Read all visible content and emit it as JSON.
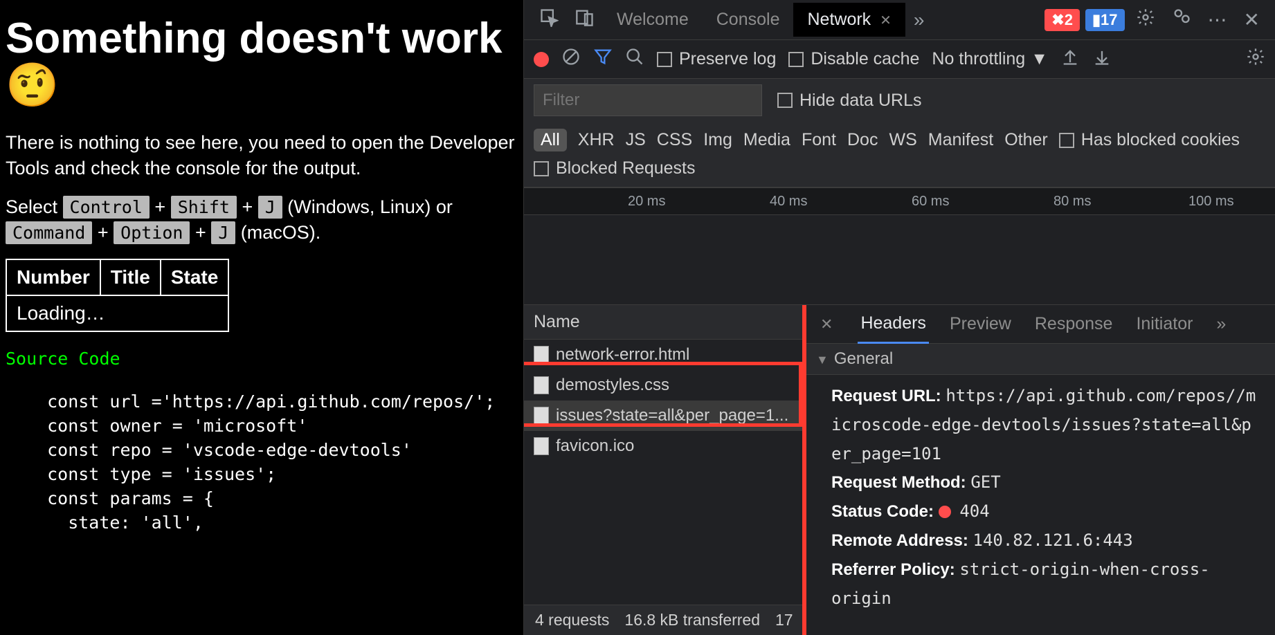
{
  "page": {
    "title": "Something doesn't work 🤨",
    "paragraph": "There is nothing to see here, you need to open the Developer Tools and check the console for the output.",
    "shortcut_prefix": "Select ",
    "kbd1": "Control",
    "plus": " + ",
    "kbd2": "Shift",
    "kbd3": "J",
    "suffix_win": " (Windows, Linux) or ",
    "kbd4": "Command",
    "kbd5": "Option",
    "kbd6": "J",
    "suffix_mac": " (macOS).",
    "table_headers": {
      "c1": "Number",
      "c2": "Title",
      "c3": "State"
    },
    "loading": "Loading…",
    "source_code_label": "Source Code",
    "code": "  const url ='https://api.github.com/repos/';\n  const owner = 'microsoft'\n  const repo = 'vscode-edge-devtools'\n  const type = 'issues';\n  const params = {\n    state: 'all',"
  },
  "tabs": {
    "welcome": "Welcome",
    "console": "Console",
    "network": "Network"
  },
  "badges": {
    "errors": "2",
    "messages": "17"
  },
  "toolbar": {
    "preserve_log": "Preserve log",
    "disable_cache": "Disable cache",
    "throttling": "No throttling"
  },
  "filter": {
    "placeholder": "Filter",
    "hide_data_urls": "Hide data URLs"
  },
  "types": {
    "all": "All",
    "xhr": "XHR",
    "js": "JS",
    "css": "CSS",
    "img": "Img",
    "media": "Media",
    "font": "Font",
    "doc": "Doc",
    "ws": "WS",
    "manifest": "Manifest",
    "other": "Other",
    "blocked_cookies": "Has blocked cookies",
    "blocked_requests": "Blocked Requests"
  },
  "ruler": {
    "t1": "20 ms",
    "t2": "40 ms",
    "t3": "60 ms",
    "t4": "80 ms",
    "t5": "100 ms"
  },
  "list_header": "Name",
  "requests": [
    {
      "name": "network-error.html"
    },
    {
      "name": "demostyles.css"
    },
    {
      "name": "issues?state=all&per_page=1..."
    },
    {
      "name": "favicon.ico"
    }
  ],
  "details_tabs": {
    "headers": "Headers",
    "preview": "Preview",
    "response": "Response",
    "initiator": "Initiator"
  },
  "general": {
    "section": "General",
    "request_url_k": "Request URL:",
    "request_url_v": "https://api.github.com/repos//microscode-edge-devtools/issues?state=all&per_page=101",
    "method_k": "Request Method:",
    "method_v": "GET",
    "status_k": "Status Code:",
    "status_v": "404",
    "remote_k": "Remote Address:",
    "remote_v": "140.82.121.6:443",
    "ref_k": "Referrer Policy:",
    "ref_v": "strict-origin-when-cross-origin"
  },
  "status": {
    "requests": "4 requests",
    "transferred": "16.8 kB transferred",
    "more": "17"
  }
}
